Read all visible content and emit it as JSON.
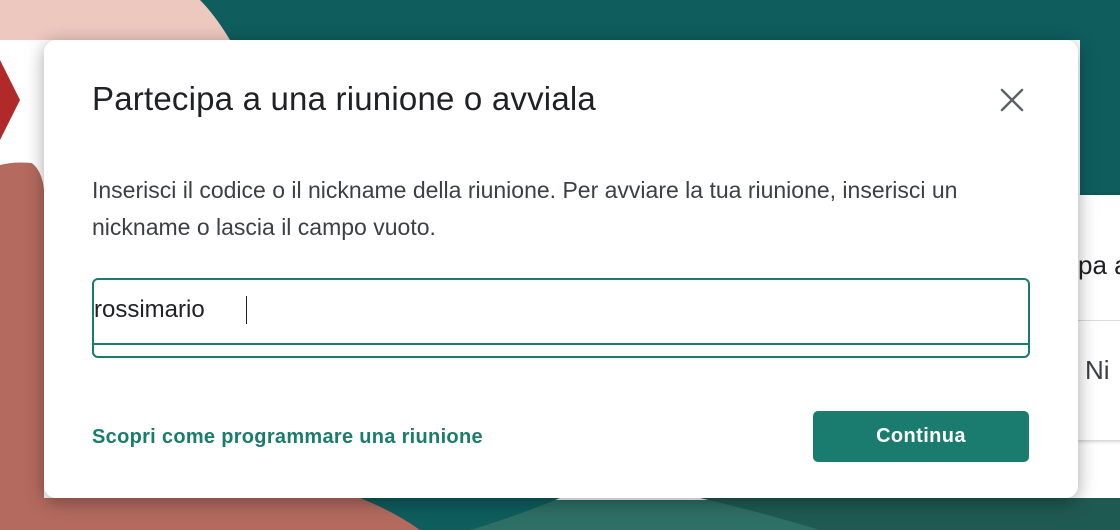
{
  "background": {
    "colors": {
      "teal": "#0f5d5d",
      "coral": "#b46a5e",
      "peach": "#e9b8ad",
      "red": "#b02a2a"
    },
    "behind_text_top": "pa a",
    "behind_text_bottom": "Ni"
  },
  "dialog": {
    "title": "Partecipa a una riunione o avviala",
    "close_icon": "close-icon",
    "description": "Inserisci il codice o il nickname della riunione. Per avviare la tua riunione, inserisci un nickname o lascia il campo vuoto.",
    "input": {
      "value": "rossimario",
      "placeholder": ""
    },
    "learn_link": "Scopri come programmare una riunione",
    "continue_label": "Continua",
    "accent_color": "#1a7c6e"
  }
}
